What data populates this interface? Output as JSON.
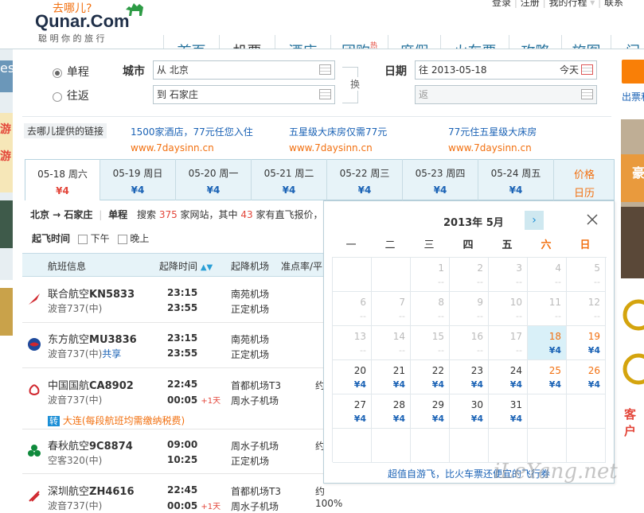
{
  "header": {
    "logo_top": "去哪儿?",
    "logo_main": "Qunar.Com",
    "logo_slogan": "聪 明 你 的 旅 行",
    "top_links": [
      "登录",
      "注册",
      "我的行程",
      "联系"
    ],
    "nav": [
      "首页",
      "机票",
      "酒店",
      "团购",
      "度假",
      "火车票",
      "攻略",
      "旅图",
      "门"
    ],
    "nav_hot": "热",
    "active_nav": "机票"
  },
  "search": {
    "trip_oneway": "单程",
    "trip_return": "往返",
    "city_label": "城市",
    "from_value": "从 北京",
    "to_value": "到 石家庄",
    "swap_label": "换",
    "date_label": "日期",
    "depart_value": "往 2013-05-18",
    "today_label": "今天",
    "return_placeholder": "返",
    "side_link": "出票和"
  },
  "ads": {
    "label": "去哪儿提供的链接",
    "items": [
      {
        "title": "1500家酒店，77元任您入住",
        "url": "www.7daysinn.cn"
      },
      {
        "title": "五星级大床房仅需77元",
        "url": "www.7daysinn.cn"
      },
      {
        "title": "77元住五星级大床房",
        "url": "www.7daysinn.cn"
      }
    ]
  },
  "date_tabs": [
    {
      "date": "05-18 周六",
      "price": "¥4",
      "active": true
    },
    {
      "date": "05-19 周日",
      "price": "¥4"
    },
    {
      "date": "05-20 周一",
      "price": "¥4"
    },
    {
      "date": "05-21 周二",
      "price": "¥4"
    },
    {
      "date": "05-22 周三",
      "price": "¥4"
    },
    {
      "date": "05-23 周四",
      "price": "¥4"
    },
    {
      "date": "05-24 周五",
      "price": "¥4"
    }
  ],
  "price_calendar_label": [
    "价格",
    "日历"
  ],
  "summary": {
    "route": "北京 → 石家庄",
    "type": "单程",
    "text1": "搜索",
    "sites": "375",
    "text2": "家网站，其中",
    "direct": "43",
    "text3": "家有直飞报价，"
  },
  "filters": {
    "label": "起飞时间",
    "pm": "下午",
    "night": "晚上"
  },
  "table_headers": [
    "航班信息",
    "起降时间",
    "起降机场",
    "准点率/平"
  ],
  "flights": [
    {
      "airline": "联合航空",
      "code": "KN5833",
      "plane": "波音737(中)",
      "dep": "23:15",
      "arr": "23:55",
      "dep_airport": "南苑机场",
      "arr_airport": "正定机场",
      "color": "#d0262d"
    },
    {
      "airline": "东方航空",
      "code": "MU3836",
      "plane": "波音737(中)",
      "share": "共享",
      "dep": "23:15",
      "arr": "23:55",
      "dep_airport": "南苑机场",
      "arr_airport": "正定机场",
      "color": "#1e4a9c"
    },
    {
      "airline": "中国国航",
      "code": "CA8902",
      "plane": "波音737(中)",
      "dep": "22:45",
      "arr": "00:05",
      "next_day": "+1天",
      "dep_airport": "首都机场T3",
      "arr_airport": "周水子机场",
      "stop_city": "大连",
      "stop_note": "(每段航班均需缴纳税费)",
      "stop_badge": "转",
      "punct": "约",
      "color": "#d0262d"
    },
    {
      "airline": "春秋航空",
      "code": "9C8874",
      "plane": "空客320(中)",
      "dep": "09:00",
      "arr": "10:25",
      "dep_airport": "周水子机场",
      "arr_airport": "正定机场",
      "punct": "约",
      "color": "#0f8a3c"
    },
    {
      "airline": "深圳航空",
      "code": "ZH4616",
      "plane": "波音737(中)",
      "dep": "22:45",
      "arr": "00:05",
      "next_day": "+1天",
      "dep_airport": "首都机场T3",
      "arr_airport": "周水子机场",
      "punct": "约100%",
      "color": "#d0262d"
    }
  ],
  "calendar": {
    "title": "2013年 5月",
    "weekdays": [
      "一",
      "二",
      "三",
      "四",
      "五",
      "六",
      "日"
    ],
    "rows": [
      [
        {
          "d": "",
          "p": ""
        },
        {
          "d": "",
          "p": ""
        },
        {
          "d": "1",
          "p": "--",
          "dis": true
        },
        {
          "d": "2",
          "p": "--",
          "dis": true
        },
        {
          "d": "3",
          "p": "--",
          "dis": true
        },
        {
          "d": "4",
          "p": "--",
          "dis": true
        },
        {
          "d": "5",
          "p": "--",
          "dis": true
        }
      ],
      [
        {
          "d": "6",
          "p": "--",
          "dis": true
        },
        {
          "d": "7",
          "p": "--",
          "dis": true
        },
        {
          "d": "8",
          "p": "--",
          "dis": true
        },
        {
          "d": "9",
          "p": "--",
          "dis": true
        },
        {
          "d": "10",
          "p": "--",
          "dis": true
        },
        {
          "d": "11",
          "p": "--",
          "dis": true
        },
        {
          "d": "12",
          "p": "--",
          "dis": true
        }
      ],
      [
        {
          "d": "13",
          "p": "--",
          "dis": true
        },
        {
          "d": "14",
          "p": "--",
          "dis": true
        },
        {
          "d": "15",
          "p": "--",
          "dis": true
        },
        {
          "d": "16",
          "p": "--",
          "dis": true
        },
        {
          "d": "17",
          "p": "--",
          "dis": true
        },
        {
          "d": "18",
          "p": "¥4",
          "sel": true,
          "wk": true
        },
        {
          "d": "19",
          "p": "¥4",
          "wk": true
        }
      ],
      [
        {
          "d": "20",
          "p": "¥4"
        },
        {
          "d": "21",
          "p": "¥4"
        },
        {
          "d": "22",
          "p": "¥4"
        },
        {
          "d": "23",
          "p": "¥4"
        },
        {
          "d": "24",
          "p": "¥4"
        },
        {
          "d": "25",
          "p": "¥4",
          "wk": true
        },
        {
          "d": "26",
          "p": "¥4",
          "wk": true
        }
      ],
      [
        {
          "d": "27",
          "p": "¥4"
        },
        {
          "d": "28",
          "p": "¥4"
        },
        {
          "d": "29",
          "p": "¥4"
        },
        {
          "d": "30",
          "p": "¥4"
        },
        {
          "d": "31",
          "p": "¥4"
        },
        {
          "d": "",
          "p": ""
        },
        {
          "d": "",
          "p": ""
        }
      ],
      [
        {
          "d": "",
          "p": ""
        },
        {
          "d": "",
          "p": ""
        },
        {
          "d": "",
          "p": ""
        },
        {
          "d": "",
          "p": ""
        },
        {
          "d": "",
          "p": ""
        },
        {
          "d": "",
          "p": ""
        },
        {
          "d": "",
          "p": ""
        }
      ]
    ],
    "footer": "超值自游飞，比火车票还便宜的飞行券"
  },
  "right_side": {
    "ad_text": "豪",
    "bottom_text": "客户"
  },
  "left_side": {
    "text1": "es",
    "text2": "游",
    "text3": "游"
  },
  "watermark": "iLeYang.net"
}
